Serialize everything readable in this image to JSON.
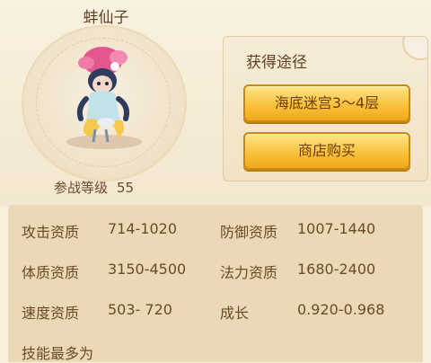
{
  "pet": {
    "name": "蚌仙子",
    "battle_level_label": "参战等级",
    "battle_level": "55"
  },
  "obtain": {
    "title": "获得途径",
    "buttons": [
      "海底迷宫3～4层",
      "商店购买"
    ]
  },
  "stats": {
    "attack": {
      "label": "攻击资质",
      "value": "714-1020"
    },
    "defense": {
      "label": "防御资质",
      "value": "1007-1440"
    },
    "physique": {
      "label": "体质资质",
      "value": "3150-4500"
    },
    "magic": {
      "label": "法力资质",
      "value": "1680-2400"
    },
    "speed": {
      "label": "速度资质",
      "value": "503- 720"
    },
    "growth": {
      "label": "成长",
      "value": "0.920-0.968"
    }
  },
  "skills": {
    "title": "技能最多为"
  },
  "colors": {
    "button_gold": "#f9c23d",
    "panel": "#ead8b6",
    "text": "#6b4a2a"
  }
}
